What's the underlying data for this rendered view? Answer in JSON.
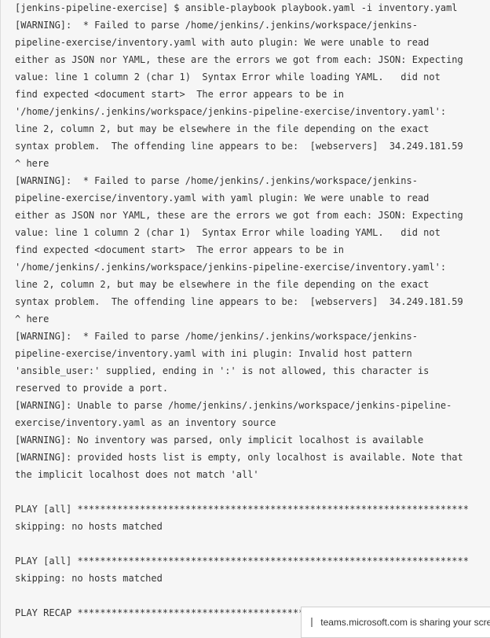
{
  "console": {
    "lines": [
      "[jenkins-pipeline-exercise] $ ansible-playbook playbook.yaml -i inventory.yaml",
      "[WARNING]:  * Failed to parse /home/jenkins/.jenkins/workspace/jenkins-",
      "pipeline-exercise/inventory.yaml with auto plugin: We were unable to read",
      "either as JSON nor YAML, these are the errors we got from each: JSON: Expecting",
      "value: line 1 column 2 (char 1)  Syntax Error while loading YAML.   did not",
      "find expected <document start>  The error appears to be in",
      "'/home/jenkins/.jenkins/workspace/jenkins-pipeline-exercise/inventory.yaml':",
      "line 2, column 2, but may be elsewhere in the file depending on the exact",
      "syntax problem.  The offending line appears to be:  [webservers]  34.249.181.59",
      "^ here",
      "[WARNING]:  * Failed to parse /home/jenkins/.jenkins/workspace/jenkins-",
      "pipeline-exercise/inventory.yaml with yaml plugin: We were unable to read",
      "either as JSON nor YAML, these are the errors we got from each: JSON: Expecting",
      "value: line 1 column 2 (char 1)  Syntax Error while loading YAML.   did not",
      "find expected <document start>  The error appears to be in",
      "'/home/jenkins/.jenkins/workspace/jenkins-pipeline-exercise/inventory.yaml':",
      "line 2, column 2, but may be elsewhere in the file depending on the exact",
      "syntax problem.  The offending line appears to be:  [webservers]  34.249.181.59",
      "^ here",
      "[WARNING]:  * Failed to parse /home/jenkins/.jenkins/workspace/jenkins-",
      "pipeline-exercise/inventory.yaml with ini plugin: Invalid host pattern",
      "'ansible_user:' supplied, ending in ':' is not allowed, this character is",
      "reserved to provide a port.",
      "[WARNING]: Unable to parse /home/jenkins/.jenkins/workspace/jenkins-pipeline-",
      "exercise/inventory.yaml as an inventory source",
      "[WARNING]: No inventory was parsed, only implicit localhost is available",
      "[WARNING]: provided hosts list is empty, only localhost is available. Note that",
      "the implicit localhost does not match 'all'",
      "",
      "PLAY [all] *********************************************************************",
      "skipping: no hosts matched",
      "",
      "PLAY [all] *********************************************************************",
      "skipping: no hosts matched",
      "",
      "PLAY RECAP *********************************************************************"
    ]
  },
  "share_banner": {
    "text": "teams.microsoft.com is sharing your screen."
  }
}
